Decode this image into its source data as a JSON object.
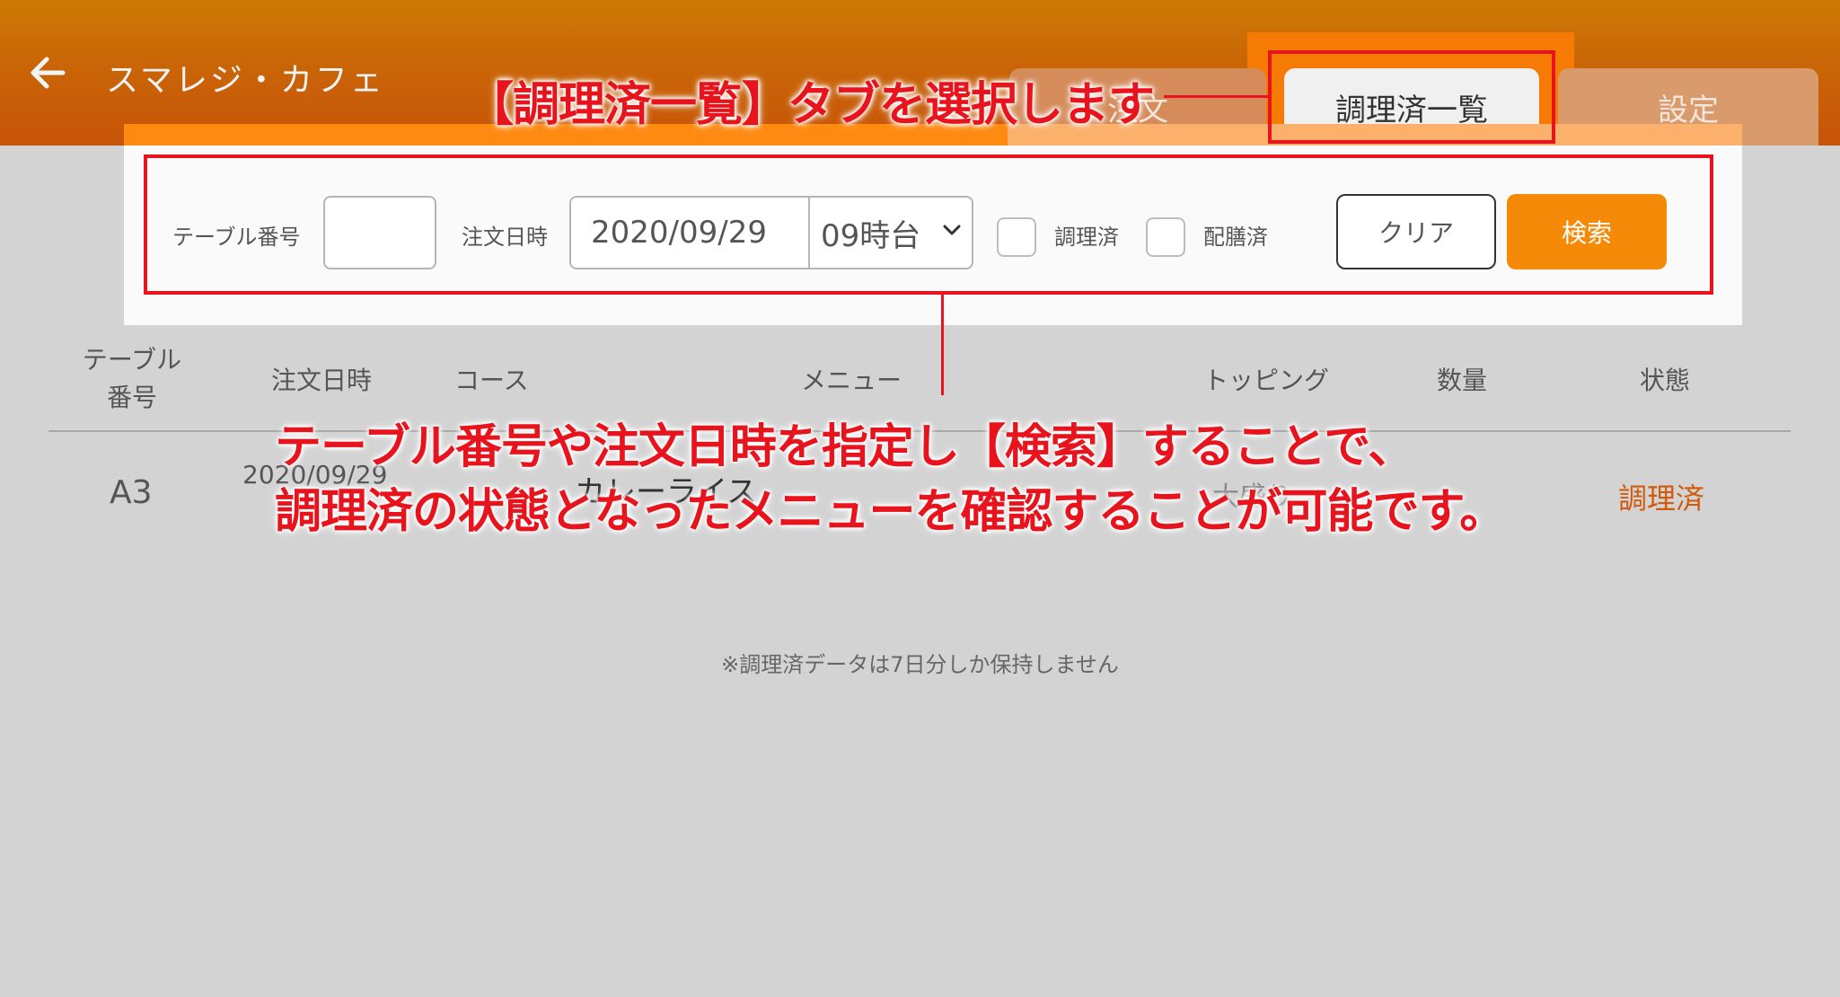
{
  "header": {
    "title": "スマレジ・カフェ"
  },
  "tabs": [
    {
      "label": "注文"
    },
    {
      "label": "調理済一覧"
    },
    {
      "label": "設定"
    }
  ],
  "filters": {
    "table_number_label": "テーブル番号",
    "table_number_value": "",
    "order_datetime_label": "注文日時",
    "date_value": "2020/09/29",
    "hour_value": "09時台",
    "cooked_label": "調理済",
    "served_label": "配膳済",
    "clear_label": "クリア",
    "search_label": "検索"
  },
  "table": {
    "headers": {
      "table_number_line1": "テーブル",
      "table_number_line2": "番号",
      "order_datetime": "注文日時",
      "course": "コース",
      "menu": "メニュー",
      "topping": "トッピング",
      "quantity": "数量",
      "status": "状態"
    },
    "rows": [
      {
        "table_number": "A3",
        "order_datetime": "2020/09/29",
        "menu": "カレーライス",
        "topping": "大盛り",
        "status": "調理済"
      }
    ]
  },
  "note": "※調理済データは7日分しか保持しません",
  "annotations": {
    "tab_callout": "【調理済一覧】タブを選択します",
    "search_callout_line1": "テーブル番号や注文日時を指定し【検索】することで、",
    "search_callout_line2": "調理済の状態となったメニューを確認することが可能です。"
  },
  "colors": {
    "accent": "#f48a07",
    "header": "#c85a08",
    "status": "#d2590a",
    "annotation": "#e8141d"
  }
}
